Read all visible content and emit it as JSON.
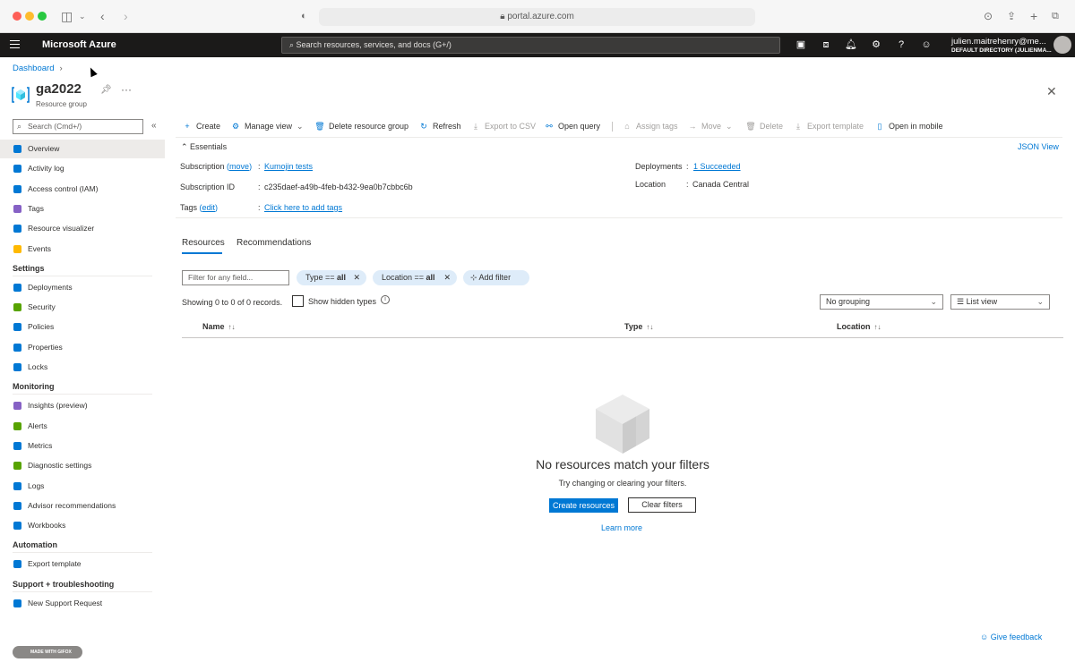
{
  "browser": {
    "url": "portal.azure.com"
  },
  "topbar": {
    "brand": "Microsoft Azure",
    "search_placeholder": "Search resources, services, and docs (G+/)",
    "user_name": "julien.maitrehenry@me...",
    "user_directory": "DEFAULT DIRECTORY (JULIENMA..."
  },
  "header": {
    "breadcrumb": "Dashboard",
    "title": "ga2022",
    "subtitle": "Resource group"
  },
  "sidebar": {
    "search_placeholder": "Search (Cmd+/)",
    "top_items": [
      {
        "label": "Overview",
        "icon": "resource-group-icon",
        "color": "#0078d4"
      },
      {
        "label": "Activity log",
        "icon": "activity-log-icon",
        "color": "#0078d4"
      },
      {
        "label": "Access control (IAM)",
        "icon": "people-icon",
        "color": "#0078d4"
      },
      {
        "label": "Tags",
        "icon": "tag-icon",
        "color": "#8661c5"
      },
      {
        "label": "Resource visualizer",
        "icon": "visualizer-icon",
        "color": "#0078d4"
      },
      {
        "label": "Events",
        "icon": "lightning-icon",
        "color": "#ffb900"
      }
    ],
    "sections": [
      {
        "title": "Settings",
        "items": [
          {
            "label": "Deployments",
            "icon": "deployments-icon",
            "color": "#0078d4"
          },
          {
            "label": "Security",
            "icon": "shield-icon",
            "color": "#57a300"
          },
          {
            "label": "Policies",
            "icon": "policies-icon",
            "color": "#0078d4"
          },
          {
            "label": "Properties",
            "icon": "properties-icon",
            "color": "#0078d4"
          },
          {
            "label": "Locks",
            "icon": "lock-icon",
            "color": "#0078d4"
          }
        ]
      },
      {
        "title": "Monitoring",
        "items": [
          {
            "label": "Insights (preview)",
            "icon": "insights-icon",
            "color": "#8661c5"
          },
          {
            "label": "Alerts",
            "icon": "alerts-icon",
            "color": "#57a300"
          },
          {
            "label": "Metrics",
            "icon": "metrics-icon",
            "color": "#0078d4"
          },
          {
            "label": "Diagnostic settings",
            "icon": "diagnostic-icon",
            "color": "#57a300"
          },
          {
            "label": "Logs",
            "icon": "logs-icon",
            "color": "#0078d4"
          },
          {
            "label": "Advisor recommendations",
            "icon": "advisor-icon",
            "color": "#0078d4"
          },
          {
            "label": "Workbooks",
            "icon": "workbooks-icon",
            "color": "#0078d4"
          }
        ]
      },
      {
        "title": "Automation",
        "items": [
          {
            "label": "Export template",
            "icon": "export-template-icon",
            "color": "#0078d4"
          }
        ]
      },
      {
        "title": "Support + troubleshooting",
        "items": [
          {
            "label": "New Support Request",
            "icon": "support-icon",
            "color": "#0078d4"
          }
        ]
      }
    ],
    "badge": "MADE WITH GIFOX"
  },
  "commands": {
    "create": "Create",
    "manage_view": "Manage view",
    "delete_rg": "Delete resource group",
    "refresh": "Refresh",
    "export_csv": "Export to CSV",
    "open_query": "Open query",
    "assign_tags": "Assign tags",
    "move": "Move",
    "delete": "Delete",
    "export_template": "Export template",
    "open_mobile": "Open in mobile"
  },
  "essentials": {
    "heading": "Essentials",
    "json_view": "JSON View",
    "subscription_label": "Subscription",
    "subscription_action": "move",
    "subscription_value": "Kumojin tests",
    "subscription_id_label": "Subscription ID",
    "subscription_id_value": "c235daef-a49b-4feb-b432-9ea0b7cbbc6b",
    "tags_label": "Tags",
    "tags_action": "edit",
    "tags_value": "Click here to add tags",
    "deployments_label": "Deployments",
    "deployments_value": "1 Succeeded",
    "location_label": "Location",
    "location_value": "Canada Central"
  },
  "tabs": [
    "Resources",
    "Recommendations"
  ],
  "filters": {
    "placeholder": "Filter for any field...",
    "type_key": "Type == ",
    "type_value": "all",
    "location_key": "Location == ",
    "location_value": "all",
    "add_filter": "Add filter",
    "records": "Showing 0 to 0 of 0 records.",
    "show_hidden": "Show hidden types",
    "grouping": "No grouping",
    "view": "List view"
  },
  "table": {
    "columns": [
      "Name",
      "Type",
      "Location"
    ]
  },
  "empty_state": {
    "title": "No resources match your filters",
    "subtitle": "Try changing or clearing your filters.",
    "create_button": "Create resources",
    "clear_button": "Clear filters",
    "learn_more": "Learn more"
  },
  "feedback": "Give feedback"
}
